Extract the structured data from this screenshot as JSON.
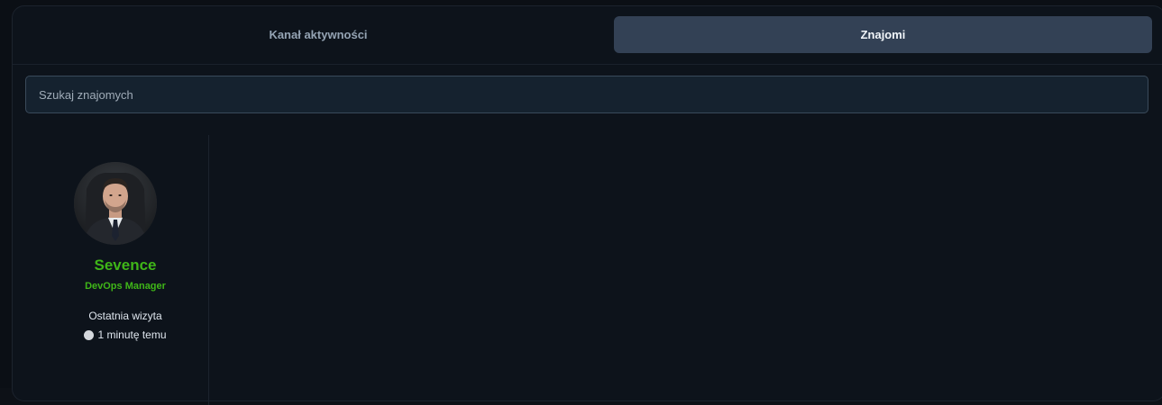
{
  "tabs": [
    {
      "label": "Kanał aktywności",
      "active": false
    },
    {
      "label": "Znajomi",
      "active": true
    }
  ],
  "search": {
    "placeholder": "Szukaj znajomych",
    "value": ""
  },
  "friends": [
    {
      "name": "Sevence",
      "role": "DevOps Manager",
      "last_visit_label": "Ostatnia wizyta",
      "last_visit_time": "1 minutę temu",
      "status_icon": "status-dot-icon",
      "name_color": "#3fb618"
    }
  ],
  "colors": {
    "background": "#0d131b",
    "active_tab": "#334155",
    "accent_green": "#3fb618"
  }
}
